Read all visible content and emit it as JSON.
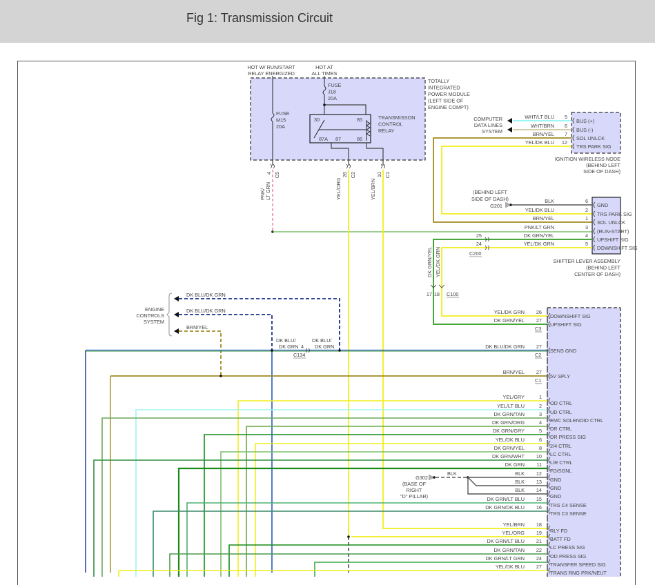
{
  "header": {
    "title": "Fig 1: Transmission Circuit"
  },
  "colors": {
    "module_fill": "#d8d8fa",
    "yellow": "#f2ee1a",
    "green": "#3c9a3c",
    "dk_green": "#178a17",
    "lt_green": "#7cbf6a",
    "navy": "#1a2f8a",
    "blue": "#2458c0",
    "brown": "#a08a22",
    "pink": "#f08aa8",
    "cyan": "#7ff2f2",
    "tan": "#c8b890",
    "black": "#555555"
  },
  "tipm": {
    "label": [
      "TOTALLY",
      "INTEGRATED",
      "POWER MODULE",
      "(LEFT SIDE OF",
      "ENGINE COMPT)"
    ],
    "hot_run": [
      "HOT W/ RUN/START",
      "RELAY ENERGIZED"
    ],
    "hot_all": [
      "HOT AT",
      "ALL TIMES"
    ],
    "fuse_m15": [
      "FUSE",
      "M15",
      "20A"
    ],
    "fuse_j18": [
      "FUSE",
      "J18",
      "20A"
    ],
    "relay": [
      "TRANSMISSON",
      "CONTROL",
      "RELAY"
    ],
    "relay_pins": [
      "30",
      "85",
      "87A",
      "87",
      "86"
    ],
    "outputs": [
      {
        "pin": "4",
        "conn": "C5",
        "wire": [
          "PNK/",
          "LT GRN"
        ]
      },
      {
        "pin": "26",
        "conn": "C2",
        "wire": [
          "YEL/ORG"
        ]
      },
      {
        "pin": "10",
        "conn": "C1",
        "wire": [
          "YEL/BRN"
        ]
      }
    ]
  },
  "ignition_node": {
    "caption": [
      "IGNITION WIRELESS NODE",
      "(BEHIND LEFT",
      "SIDE OF DASH)"
    ],
    "computer_lines": [
      "COMPUTER",
      "DATA LINES",
      "SYSTEM"
    ],
    "pins": [
      {
        "num": "5",
        "wire": "WHT/LT BLU",
        "signal": "BUS (+)"
      },
      {
        "num": "6",
        "wire": "WHT/BRN",
        "signal": "BUS (-)"
      },
      {
        "num": "7",
        "wire": "BRN/YEL",
        "signal": "SOL UNLCK"
      },
      {
        "num": "12",
        "wire": "YEL/DK BLU",
        "signal": "TRS PARK SIG"
      }
    ]
  },
  "shifter": {
    "caption": [
      "SHIFTER LEVER ASSEMBLY",
      "(BEHIND LEFT",
      "CENTER OF DASH)"
    ],
    "ground": {
      "name": "G201",
      "location": [
        "(BEHIND LEFT",
        "SIDE OF DASH)"
      ]
    },
    "pins": [
      {
        "num": "6",
        "wire": "BLK",
        "signal": "GND"
      },
      {
        "num": "2",
        "wire": "YEL/DK BLU",
        "signal": "TRS PARK SIG"
      },
      {
        "num": "1",
        "wire": "BRN/YEL",
        "signal": "SOL UNLCK"
      },
      {
        "num": "3",
        "wire": "PNK/LT GRN",
        "signal": "(RUN-START)"
      },
      {
        "num": "4",
        "wire": "DK GRN/YEL",
        "signal": "UPSHIFT SIG"
      },
      {
        "num": "5",
        "wire": "YEL/DK GRN",
        "signal": "DOWNSHIFT SIG"
      }
    ],
    "c200": {
      "name": "C200",
      "pins": [
        "25",
        "24"
      ]
    },
    "c100": {
      "name": "C100",
      "pins": [
        "17",
        "18"
      ],
      "wires": [
        "DK GRN/YEL",
        "YEL/DK GRN"
      ]
    }
  },
  "engine_controls": {
    "label": [
      "ENGINE",
      "CONTROLS",
      "SYSTEM"
    ],
    "wires": [
      "DK BLU/DK GRN",
      "DK BLU/DK GRN",
      "BRN/YEL"
    ],
    "c134": {
      "name": "C134",
      "pin": "4",
      "wire_a": [
        "DK BLU/",
        "DK GRN"
      ],
      "wire_b": [
        "DK BLU/",
        "DK GRN"
      ]
    }
  },
  "pcm": {
    "top_pins": [
      {
        "num": "26",
        "wire": "YEL/DK GRN",
        "signal": "DOWNSHIFT SIG"
      },
      {
        "num": "27",
        "wire": "DK GRN/YEL",
        "signal": "UPSHIFT SIG",
        "conn": "C3"
      },
      {
        "num": "27",
        "wire": "DK BLU/DK GRN",
        "signal": "SENS GND",
        "conn": "C2"
      },
      {
        "num": "27",
        "wire": "BRN/YEL",
        "signal": "5V SPLY",
        "conn": "C1"
      }
    ],
    "pins": [
      {
        "num": "1",
        "wire": "YEL/GRY",
        "signal": "OD CTRL",
        "color": "#f2ee1a"
      },
      {
        "num": "2",
        "wire": "YEL/LT BLU",
        "signal": "UD CTRL",
        "color": "#9ff5f0"
      },
      {
        "num": "3",
        "wire": "DK GRN/TAN",
        "signal": "EMC SOLENOID CTRL",
        "color": "#6aaa5a"
      },
      {
        "num": "4",
        "wire": "DK GRN/ORG",
        "signal": "DR CTRL",
        "color": "#6aa84a"
      },
      {
        "num": "5",
        "wire": "DK GRN/GRY",
        "signal": "DR PRESS SIG",
        "color": "#178a17"
      },
      {
        "num": "6",
        "wire": "YEL/DK BLU",
        "signal": "2/4 CTRL",
        "color": "#f2ee1a"
      },
      {
        "num": "8",
        "wire": "DK GRN/YEL",
        "signal": "LC CTRL",
        "color": "#7cbf6a"
      },
      {
        "num": "10",
        "wire": "DK GRN/WHT",
        "signal": "L/R CTRL",
        "color": "#2f8f3f"
      },
      {
        "num": "11",
        "wire": "DK GRN",
        "signal": "FD/SGNL",
        "color": "#178a17"
      },
      {
        "num": "12",
        "wire": "BLK",
        "signal": "GND",
        "color": "#555555"
      },
      {
        "num": "13",
        "wire": "BLK",
        "signal": "GND",
        "color": "#555555"
      },
      {
        "num": "14",
        "wire": "BLK",
        "signal": "GND",
        "color": "#555555"
      },
      {
        "num": "15",
        "wire": "DK GRN/LT BLU",
        "signal": "TRS C4 SENSE",
        "color": "#4ab070"
      },
      {
        "num": "16",
        "wire": "DK GRN/DK BLU",
        "signal": "TRS C3 SENSE",
        "color": "#3a8a6a"
      },
      {
        "num": "18",
        "wire": "YEL/BRN",
        "signal": "RLY FD",
        "color": "#f2ee1a"
      },
      {
        "num": "19",
        "wire": "YEL/ORG",
        "signal": "BATT FD",
        "color": "#f2ee1a"
      },
      {
        "num": "21",
        "wire": "DK GRN/LT BLU",
        "signal": "LC PRESS SIG",
        "color": "#178a17"
      },
      {
        "num": "22",
        "wire": "DK GRN/TAN",
        "signal": "OD PRESS SIG",
        "color": "#4a9a4a"
      },
      {
        "num": "24",
        "wire": "DK GRN/LT GRN",
        "signal": "TRANSFER SPEED SIG",
        "color": "#3aaa4a"
      },
      {
        "num": "27",
        "wire": "YEL/DK BLU",
        "signal": "TRANS RNG PRK/NEUT",
        "color": "#f2ee1a"
      }
    ],
    "ground": {
      "name": "G302",
      "wire": "BLK",
      "location": [
        "(BASE OF",
        "RIGHT",
        "\"D\" PILLAR)"
      ]
    }
  }
}
